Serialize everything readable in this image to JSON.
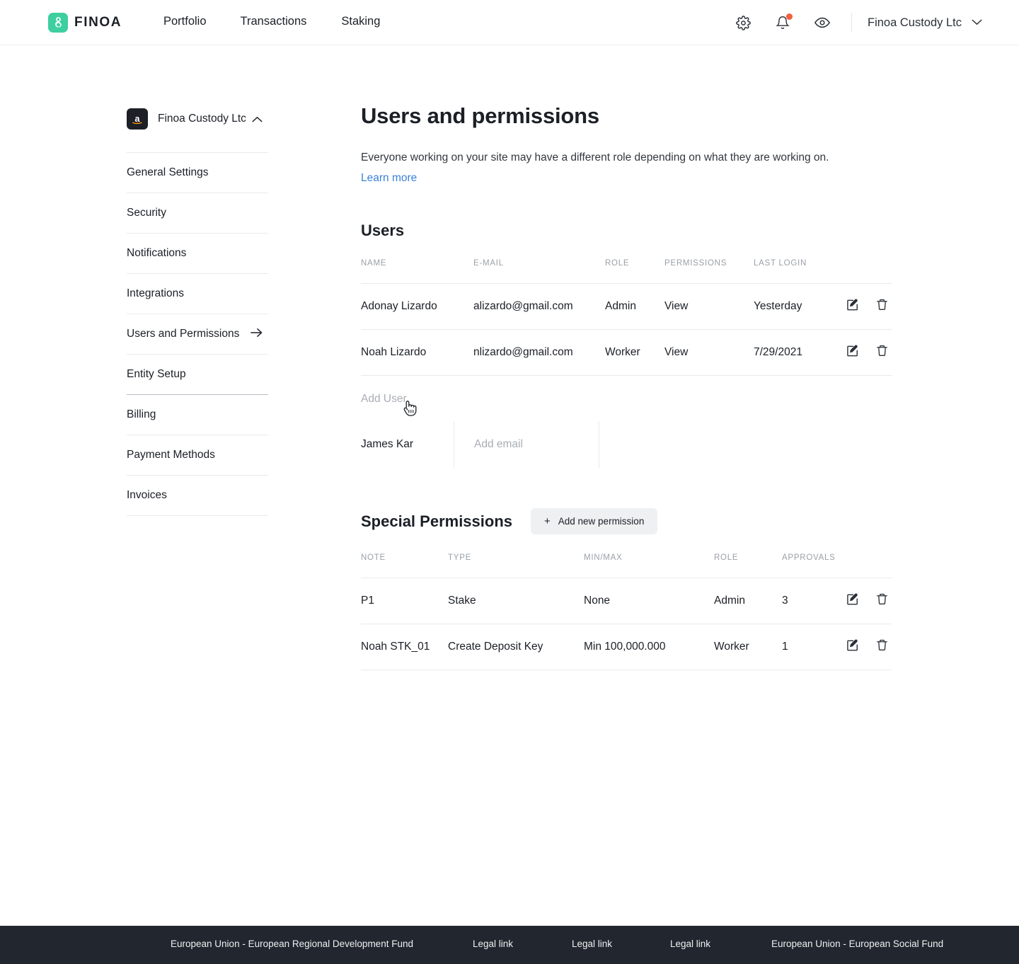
{
  "brand": {
    "name": "FINOA",
    "logo_icon": "finoa-logo-icon",
    "accent": "#3ECFA0"
  },
  "topnav": {
    "links": [
      {
        "label": "Portfolio"
      },
      {
        "label": "Transactions"
      },
      {
        "label": "Staking"
      }
    ],
    "icons": [
      {
        "name": "gear-icon"
      },
      {
        "name": "bell-icon",
        "badge": true,
        "badge_color": "#F4603E"
      },
      {
        "name": "eye-icon"
      }
    ],
    "org": {
      "label": "Finoa Custody Ltc",
      "chevron": "chevron-down-icon"
    }
  },
  "sidebar": {
    "org": {
      "label": "Finoa Custody Ltc",
      "avatar_icon": "amazon-avatar-icon",
      "chevron": "chevron-up-icon"
    },
    "items": [
      {
        "label": "General Settings",
        "active": false,
        "arrow": false
      },
      {
        "label": "Security",
        "active": false,
        "arrow": false
      },
      {
        "label": "Notifications",
        "active": false,
        "arrow": false
      },
      {
        "label": "Integrations",
        "active": false,
        "arrow": false
      },
      {
        "label": "Users and Permissions",
        "active": true,
        "arrow": true
      },
      {
        "label": "Entity Setup",
        "active": false,
        "arrow": false
      },
      {
        "label": "Billing",
        "active": false,
        "arrow": false
      },
      {
        "label": "Payment Methods",
        "active": false,
        "arrow": false
      },
      {
        "label": "Invoices",
        "active": false,
        "arrow": false
      }
    ]
  },
  "main": {
    "title": "Users and permissions",
    "description": "Everyone working on your site may have a different role depending on what they are working on.",
    "learn_more": "Learn more",
    "users_section": {
      "title": "Users",
      "columns": [
        "NAME",
        "E-MAIL",
        "ROLE",
        "PERMISSIONS",
        "LAST LOGIN"
      ],
      "rows": [
        {
          "name": "Adonay Lizardo",
          "email": "alizardo@gmail.com",
          "role": "Admin",
          "permissions": "View",
          "last_login": "Yesterday"
        },
        {
          "name": "Noah Lizardo",
          "email": "nlizardo@gmail.com",
          "role": "Worker",
          "permissions": "View",
          "last_login": "7/29/2021"
        }
      ],
      "add_user_label": "Add User",
      "new_row": {
        "name": "James Kar",
        "email_value": "",
        "email_placeholder": "Add email"
      }
    },
    "permissions_section": {
      "title": "Special Permissions",
      "add_button": "Add new permission",
      "columns": [
        "NOTE",
        "TYPE",
        "MIN/MAX",
        "ROLE",
        "APPROVALS"
      ],
      "rows": [
        {
          "note": "P1",
          "type": "Stake",
          "minmax": "None",
          "role": "Admin",
          "approvals": "3"
        },
        {
          "note": "Noah STK_01",
          "type": "Create Deposit Key",
          "minmax": "Min 100,000.000",
          "role": "Worker",
          "approvals": "1"
        }
      ]
    },
    "row_action_icons": {
      "edit": "edit-icon",
      "delete": "trash-icon"
    }
  },
  "footer": {
    "background": "#22262F",
    "links": [
      "European Union - European Regional Development Fund",
      "Legal link",
      "Legal link",
      "Legal link",
      "European Union - European Social Fund"
    ]
  }
}
